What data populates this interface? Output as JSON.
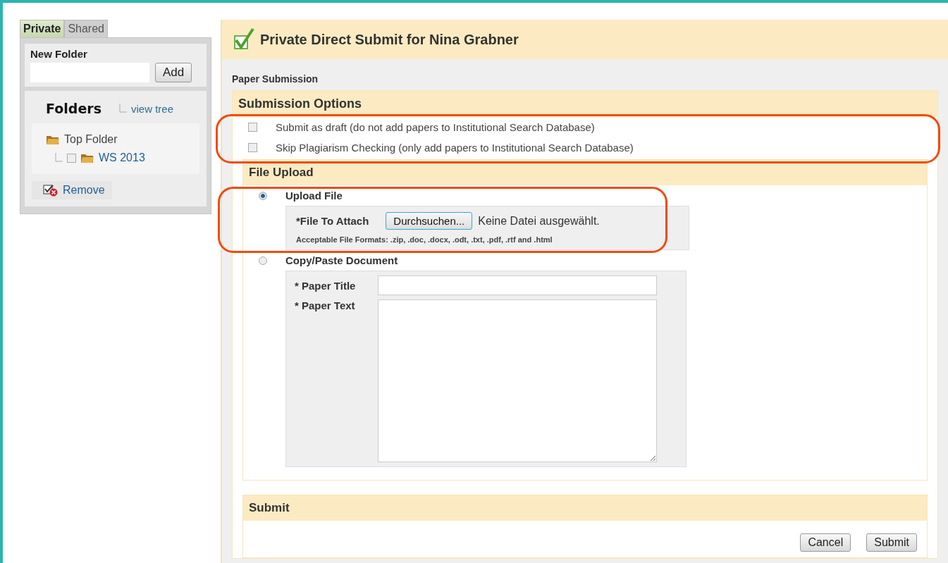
{
  "sidebar": {
    "tabs": [
      {
        "label": "Private",
        "selected": true
      },
      {
        "label": "Shared",
        "selected": false
      }
    ],
    "new_folder": {
      "label": "New Folder",
      "button": "Add"
    },
    "folders": {
      "title": "Folders",
      "view_tree": "view tree",
      "tree": [
        {
          "label": "Top Folder",
          "children": [
            {
              "label": "WS 2013",
              "checked": false
            }
          ]
        }
      ]
    },
    "remove": "Remove"
  },
  "header": {
    "title": "Private Direct Submit for Nina Grabner"
  },
  "breadcrumb": "Paper Submission",
  "submission_options": {
    "title": "Submission Options",
    "highlighted": true,
    "options": [
      {
        "label": "Submit as draft (do not add papers to Institutional Search Database)",
        "checked": false
      },
      {
        "label": "Skip Plagiarism Checking (only add papers to Institutional Search Database)",
        "checked": false
      }
    ]
  },
  "file_upload": {
    "title": "File Upload",
    "methods": [
      {
        "kind": "upload",
        "label": "Upload File",
        "selected": true,
        "highlighted": true,
        "field_label": "*File To Attach",
        "browse_button": "Durchsuchen...",
        "file_status": "Keine Datei ausgewählt.",
        "formats": "Acceptable File Formats: .zip, .doc, .docx, .odt, .txt, .pdf, .rtf and .html"
      },
      {
        "kind": "paste",
        "label": "Copy/Paste Document",
        "selected": false,
        "highlighted": false,
        "title_label": "* Paper Title",
        "text_label": "* Paper Text"
      }
    ]
  },
  "submit": {
    "title": "Submit",
    "buttons": [
      "Cancel",
      "Submit"
    ]
  }
}
